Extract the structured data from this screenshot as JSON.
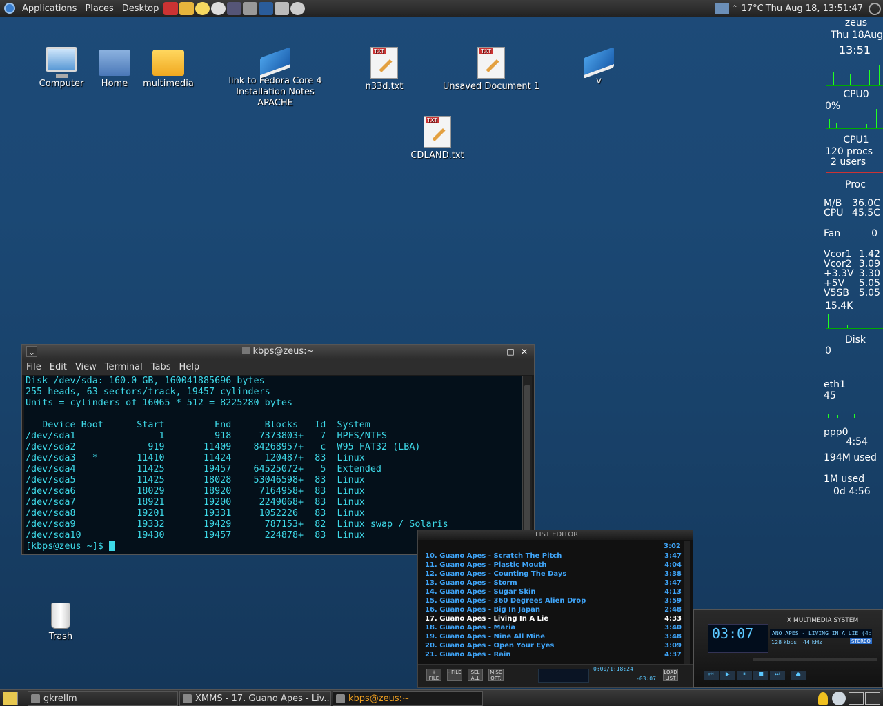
{
  "topbar": {
    "menus": [
      "Applications",
      "Places",
      "Desktop"
    ],
    "weather": "17°C",
    "clock": "Thu Aug 18, 13:51:47"
  },
  "desktop": {
    "icons": [
      {
        "label": "Computer",
        "kind": "computer"
      },
      {
        "label": "Home",
        "kind": "home"
      },
      {
        "label": "multimedia",
        "kind": "folder"
      },
      {
        "label": "link to Fedora Core 4 Installation Notes APACHE",
        "kind": "book"
      },
      {
        "label": "n33d.txt",
        "kind": "text"
      },
      {
        "label": "Unsaved Document 1",
        "kind": "text"
      },
      {
        "label": "v",
        "kind": "book"
      },
      {
        "label": "CDLAND.txt",
        "kind": "text"
      },
      {
        "label": "Trash",
        "kind": "trash"
      }
    ]
  },
  "gkrellm": {
    "host": "zeus",
    "date": "Thu 18Aug",
    "time": "13:51",
    "cpu0_label": "CPU0",
    "cpu0_val": "0%",
    "cpu1_label": "CPU1",
    "procs": "120 procs",
    "users": "2 users",
    "proc_label": "Proc",
    "mb_label": "M/B",
    "mb_val": "36.0C",
    "cpu_label": "CPU",
    "cpu_val": "45.5C",
    "fan_label": "Fan",
    "fan_val": "0",
    "vcor1_label": "Vcor1",
    "vcor1": "1.42",
    "vcor2_label": "Vcor2",
    "vcor2": "3.09",
    "v33_label": "+3.3V",
    "v33": "3.30",
    "v5_label": "+5V",
    "v5": "5.05",
    "v5sb_label": "V5SB",
    "v5sb": "5.05",
    "disk_rate": "15.4K",
    "disk_label": "Disk",
    "disk_val": "0",
    "eth_label": "eth1",
    "eth_val": "45",
    "ppp_label": "ppp0",
    "ppp_time": "4:54",
    "mem": "194M used",
    "swap": "1M used",
    "uptime": "0d 4:56"
  },
  "terminal": {
    "title": "kbps@zeus:~",
    "menus": [
      "File",
      "Edit",
      "View",
      "Terminal",
      "Tabs",
      "Help"
    ],
    "lines": [
      "Disk /dev/sda: 160.0 GB, 160041885696 bytes",
      "255 heads, 63 sectors/track, 19457 cylinders",
      "Units = cylinders of 16065 * 512 = 8225280 bytes",
      "",
      "   Device Boot      Start         End      Blocks   Id  System",
      "/dev/sda1               1         918     7373803+   7  HPFS/NTFS",
      "/dev/sda2             919       11409    84268957+   c  W95 FAT32 (LBA)",
      "/dev/sda3   *       11410       11424      120487+  83  Linux",
      "/dev/sda4           11425       19457    64525072+   5  Extended",
      "/dev/sda5           11425       18028    53046598+  83  Linux",
      "/dev/sda6           18029       18920     7164958+  83  Linux",
      "/dev/sda7           18921       19200     2249068+  83  Linux",
      "/dev/sda8           19201       19331     1052226   83  Linux",
      "/dev/sda9           19332       19429      787153+  82  Linux swap / Solaris",
      "/dev/sda10          19430       19457      224878+  83  Linux"
    ],
    "prompt": "[kbps@zeus ~]$ "
  },
  "playlist": {
    "title": "LIST EDITOR",
    "first_time": "3:02",
    "items": [
      {
        "t": "10. Guano Apes - Scratch The Pitch",
        "d": "3:47"
      },
      {
        "t": "11. Guano Apes - Plastic Mouth",
        "d": "4:04"
      },
      {
        "t": "12. Guano Apes - Counting The Days",
        "d": "3:38"
      },
      {
        "t": "13. Guano Apes - Storm",
        "d": "3:47"
      },
      {
        "t": "14. Guano Apes - Sugar Skin",
        "d": "4:13"
      },
      {
        "t": "15. Guano Apes - 360 Degrees Alien Drop",
        "d": "3:59"
      },
      {
        "t": "16. Guano Apes - Big In Japan",
        "d": "2:48"
      },
      {
        "t": "17. Guano Apes - Living In A Lie",
        "d": "4:33"
      },
      {
        "t": "18. Guano Apes - Maria",
        "d": "3:40"
      },
      {
        "t": "19. Guano Apes - Nine All Mine",
        "d": "3:48"
      },
      {
        "t": "20. Guano Apes - Open Your Eyes",
        "d": "3:09"
      },
      {
        "t": "21. Guano Apes - Rain",
        "d": "4:37"
      }
    ],
    "buttons": [
      "+ FILE",
      "- FILE",
      "SEL ALL",
      "MISC OPT.",
      "LOAD LIST"
    ],
    "total": "0:00/1:18:24",
    "remain": "-03:07",
    "current_index": 7
  },
  "xmms": {
    "title": "X MULTIMEDIA SYSTEM",
    "time": "03:07",
    "song": "ANO APES - LIVING IN A LIE (4:3",
    "kbps": "128 kbps",
    "khz": "44 kHz",
    "stereo": "STEREO"
  },
  "taskbar": {
    "tasks": [
      "gkrellm",
      "XMMS - 17. Guano Apes - Liv...",
      "kbps@zeus:~"
    ]
  }
}
